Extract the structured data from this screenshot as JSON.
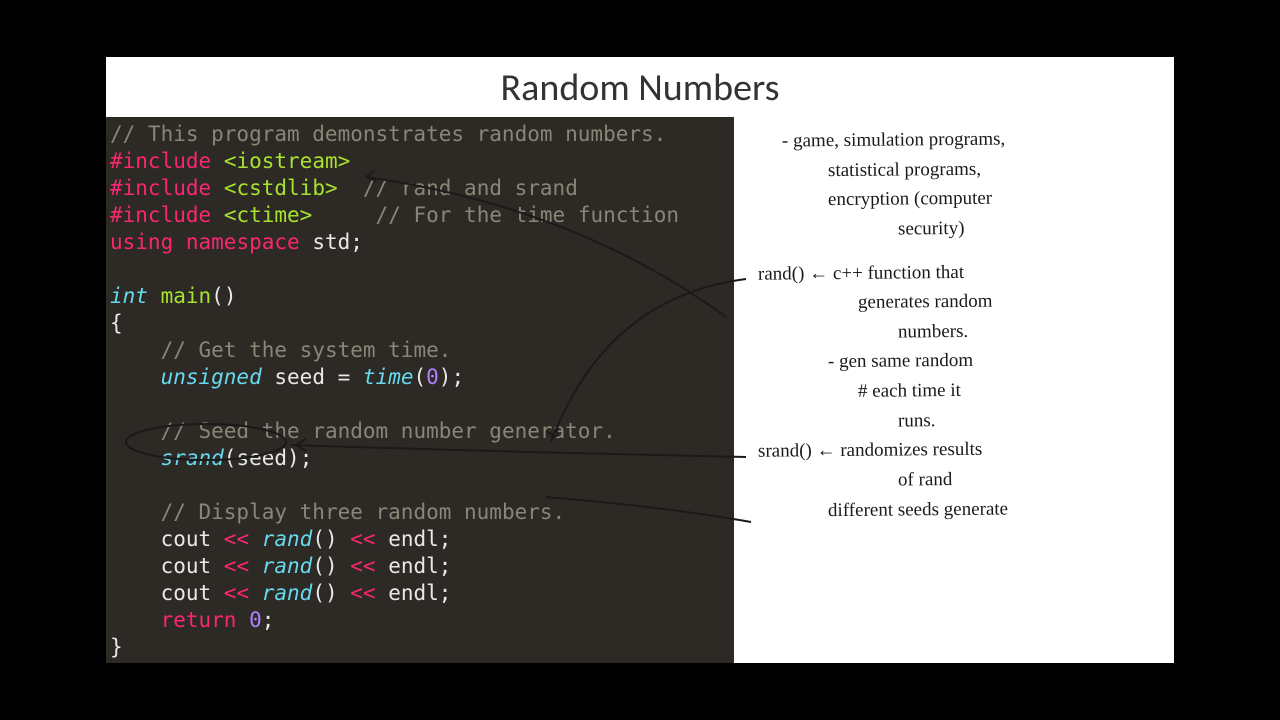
{
  "title": "Random Numbers",
  "code": {
    "l1_comment": "// This program demonstrates random numbers.",
    "include_kw": "#include",
    "iostream": "<iostream>",
    "cstdlib": "<cstdlib>",
    "cstdlib_comment": "// rand and srand",
    "ctime": "<ctime>",
    "ctime_comment": "// For the time function",
    "using": "using",
    "namespace": "namespace",
    "std": "std",
    "semi": ";",
    "int_kw": "int",
    "main": "main",
    "parens": "()",
    "lbrace": "{",
    "rbrace": "}",
    "get_time_comment": "// Get the system time.",
    "unsigned_kw": "unsigned",
    "seed_var": "seed",
    "eq": " = ",
    "time_fn": "time",
    "zero": "0",
    "seed_comment": "// Seed the random number generator.",
    "srand_fn": "srand",
    "display_comment": "// Display three random numbers.",
    "cout": "cout",
    "stream": " << ",
    "rand_fn": "rand",
    "endl": "endl",
    "return_kw": "return",
    "return_val": "0"
  },
  "notes": {
    "n1": "- game, simulation programs,",
    "n2": "statistical programs,",
    "n3": "encryption (computer",
    "n4": "security)",
    "n5": "rand() ← c++ function that",
    "n6": "generates random",
    "n7": "numbers.",
    "n8": "- gen same random",
    "n9": "# each time it",
    "n10": "runs.",
    "n11": "srand() ← randomizes results",
    "n12": "of rand",
    "n13": "different seeds generate",
    "arrow": "←"
  }
}
